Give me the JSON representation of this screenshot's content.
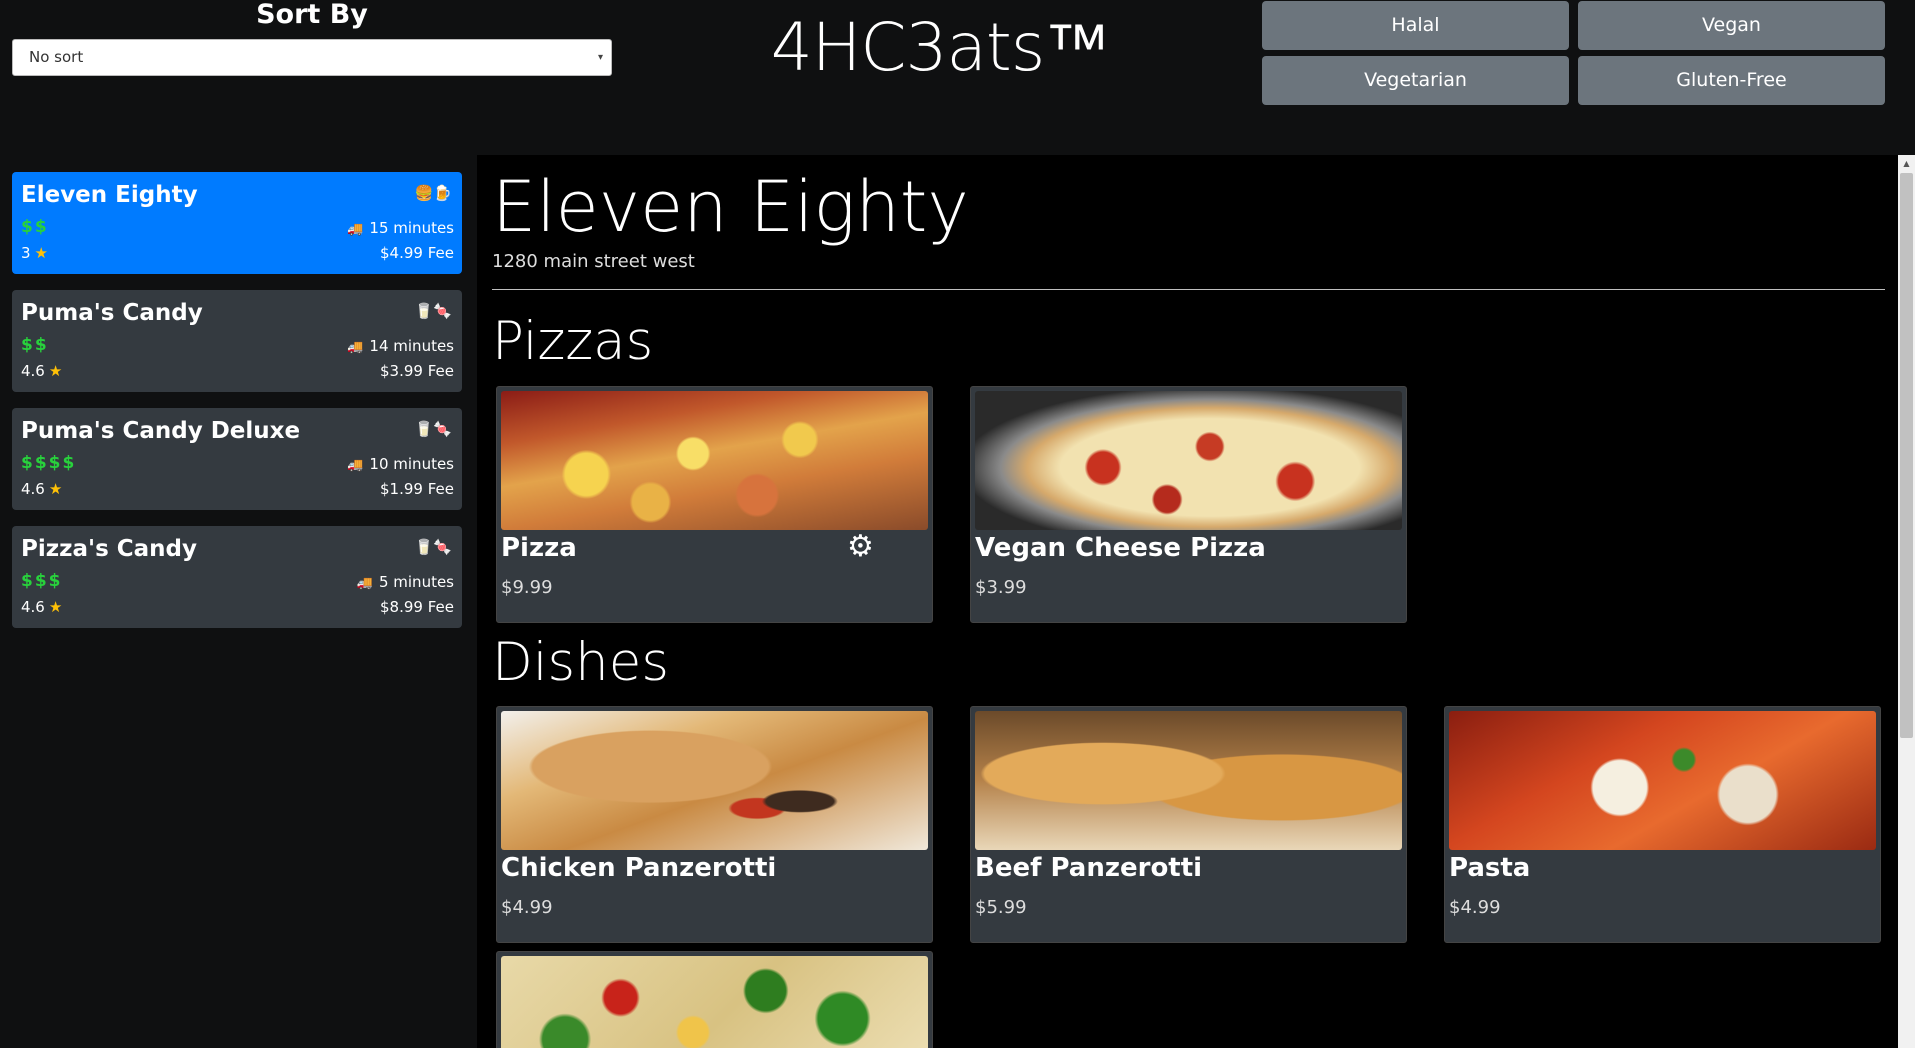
{
  "header": {
    "sort_label": "Sort By",
    "sort_value": "No sort",
    "brand": "4HC3ats™",
    "filters": [
      "Halal",
      "Vegan",
      "Vegetarian",
      "Gluten-Free"
    ]
  },
  "restaurants": [
    {
      "name": "Eleven Eighty",
      "price": "$$",
      "time": "15 minutes",
      "rating": "3",
      "fee": "$4.99 Fee",
      "icons": "🍔🍺",
      "active": true
    },
    {
      "name": "Puma's Candy",
      "price": "$$",
      "time": "14 minutes",
      "rating": "4.6",
      "fee": "$3.99 Fee",
      "icons": "🥛🍬",
      "active": false
    },
    {
      "name": "Puma's Candy Deluxe",
      "price": "$$$$",
      "time": "10 minutes",
      "rating": "4.6",
      "fee": "$1.99 Fee",
      "icons": "🥛🍬",
      "active": false
    },
    {
      "name": "Pizza's Candy",
      "price": "$$$",
      "time": "5 minutes",
      "rating": "4.6",
      "fee": "$8.99 Fee",
      "icons": "🥛🍬",
      "active": false
    }
  ],
  "main": {
    "title": "Eleven Eighty",
    "address": "1280 main street west",
    "sections": [
      {
        "title": "Pizzas",
        "items": [
          {
            "name": "Pizza",
            "price": "$9.99"
          },
          {
            "name": "Vegan Cheese Pizza",
            "price": "$3.99"
          }
        ]
      },
      {
        "title": "Dishes",
        "items": [
          {
            "name": "Chicken Panzerotti",
            "price": "$4.99"
          },
          {
            "name": "Beef Panzerotti",
            "price": "$5.99"
          },
          {
            "name": "Pasta",
            "price": "$4.99"
          }
        ]
      }
    ]
  },
  "icons": {
    "caret": "▾",
    "truck": "🚚",
    "star": "★",
    "gear": "⚙",
    "scroll_up": "▲"
  }
}
